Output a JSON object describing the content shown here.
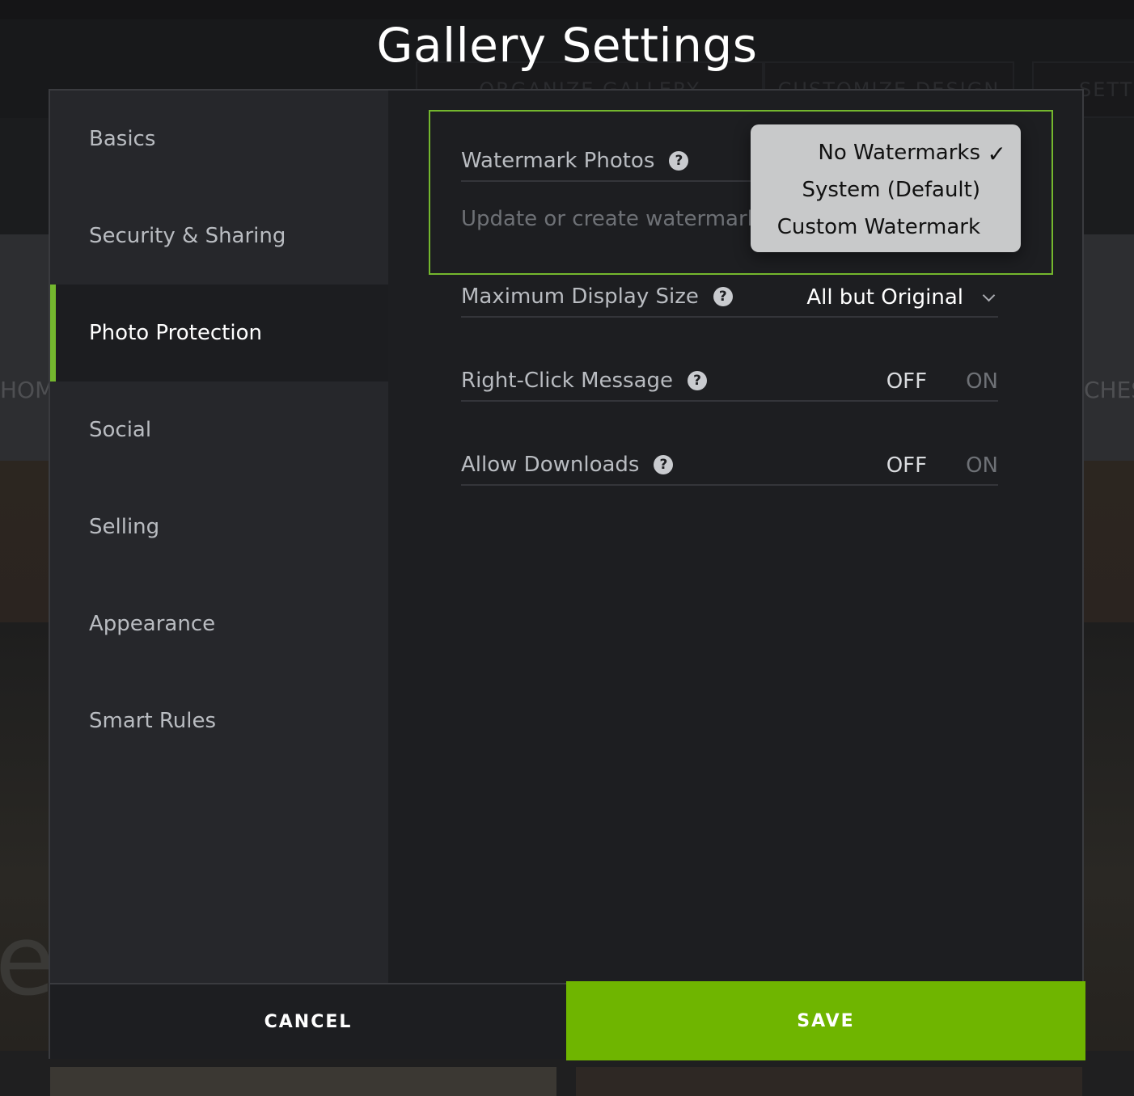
{
  "background": {
    "tabs": [
      "ORGANIZE GALLERY",
      "CUSTOMIZE DESIGN",
      "SETTI"
    ],
    "side_left": "HOM",
    "side_right": "CHES",
    "big_letter": "e"
  },
  "modal": {
    "title": "Gallery Settings",
    "sidebar": {
      "items": [
        {
          "label": "Basics"
        },
        {
          "label": "Security & Sharing"
        },
        {
          "label": "Photo Protection"
        },
        {
          "label": "Social"
        },
        {
          "label": "Selling"
        },
        {
          "label": "Appearance"
        },
        {
          "label": "Smart Rules"
        }
      ],
      "active_index": 2
    },
    "settings": {
      "watermark": {
        "label": "Watermark Photos",
        "sub_text": "Update or create watermark",
        "help_icon": "?",
        "options": [
          {
            "label": "No Watermarks",
            "selected": true,
            "check": "✓"
          },
          {
            "label": "System (Default)",
            "selected": false
          },
          {
            "label": "Custom Watermark",
            "selected": false
          }
        ]
      },
      "display_size": {
        "label": "Maximum Display Size",
        "help_icon": "?",
        "value": "All but Original"
      },
      "right_click": {
        "label": "Right-Click Message",
        "help_icon": "?",
        "off_label": "OFF",
        "on_label": "ON",
        "state": "OFF"
      },
      "downloads": {
        "label": "Allow Downloads",
        "help_icon": "?",
        "off_label": "OFF",
        "on_label": "ON",
        "state": "OFF"
      }
    },
    "footer": {
      "cancel_label": "CANCEL",
      "save_label": "SAVE"
    },
    "colors": {
      "accent": "#74b72e",
      "save_button": "#6fb500",
      "modal_bg": "#1d1e21",
      "sidebar_bg": "#26272b"
    }
  }
}
